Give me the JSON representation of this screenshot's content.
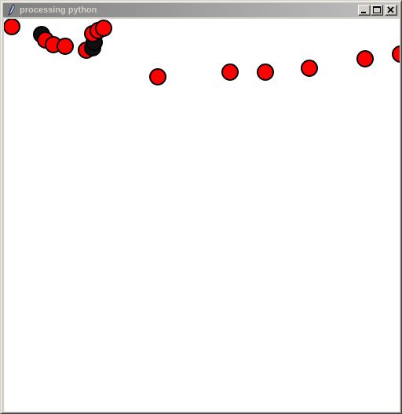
{
  "window": {
    "title": "processing python",
    "icon": "feather-pen-icon",
    "controls": {
      "minimize": "minimize-icon",
      "maximize": "maximize-icon",
      "close": "close-icon"
    }
  },
  "colors": {
    "ball_fill": "#ff0000",
    "ball_stroke": "#000000",
    "shadow_ball": "#111111",
    "canvas_bg": "#ffffff"
  }
}
